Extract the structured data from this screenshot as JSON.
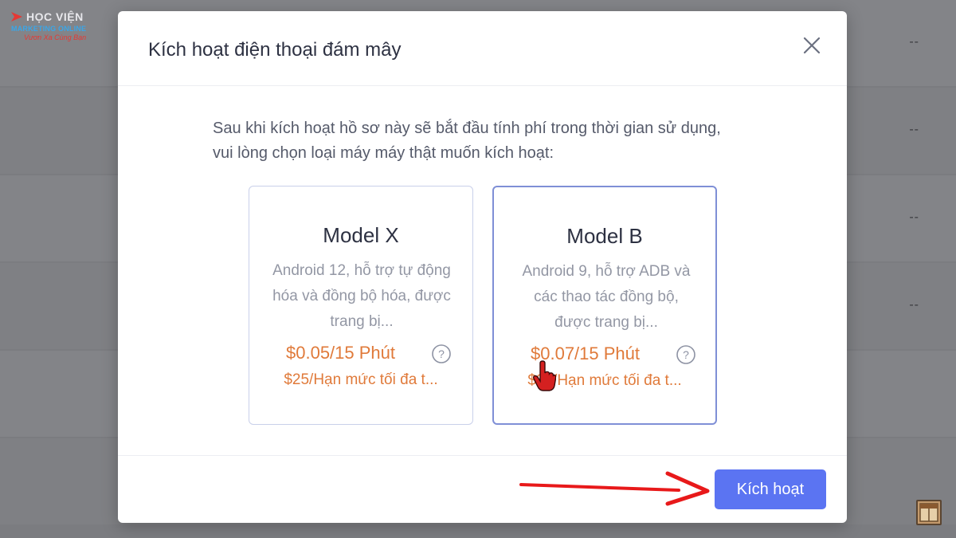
{
  "watermark": {
    "title": "HỌC VIỆN",
    "subtitle": "MARKETING ONLINE",
    "tagline": "Vươn Xa Cùng Bạn"
  },
  "background": {
    "row_placeholders": [
      "--",
      "--",
      "--",
      "--"
    ]
  },
  "modal": {
    "title": "Kích hoạt điện thoại đám mây",
    "description": "Sau khi kích hoạt hồ sơ này sẽ bắt đầu tính phí trong thời gian sử dụng, vui lòng chọn loại máy máy thật muốn kích hoạt:",
    "cards": [
      {
        "name": "Model X",
        "description": "Android 12, hỗ trợ tự động hóa và đồng bộ hóa, được trang bị...",
        "price": "$0.05/15 Phút",
        "limit": "$25/Hạn mức tối đa t...",
        "selected": false
      },
      {
        "name": "Model B",
        "description": "Android 9, hỗ trợ ADB và các thao tác đồng bộ, được trang bị...",
        "price": "$0.07/15 Phút",
        "limit": "$25/Hạn mức tối đa t...",
        "selected": true
      }
    ],
    "activate_label": "Kích hoạt"
  },
  "colors": {
    "accent": "#5b74f2",
    "price": "#e07a3a",
    "selected_border": "#7f8fd6",
    "annotation": "#e8191a"
  },
  "icons": {
    "close": "close-icon",
    "help": "question-circle-icon",
    "cursor": "hand-pointer-icon",
    "arrow": "red-arrow-annotation"
  }
}
